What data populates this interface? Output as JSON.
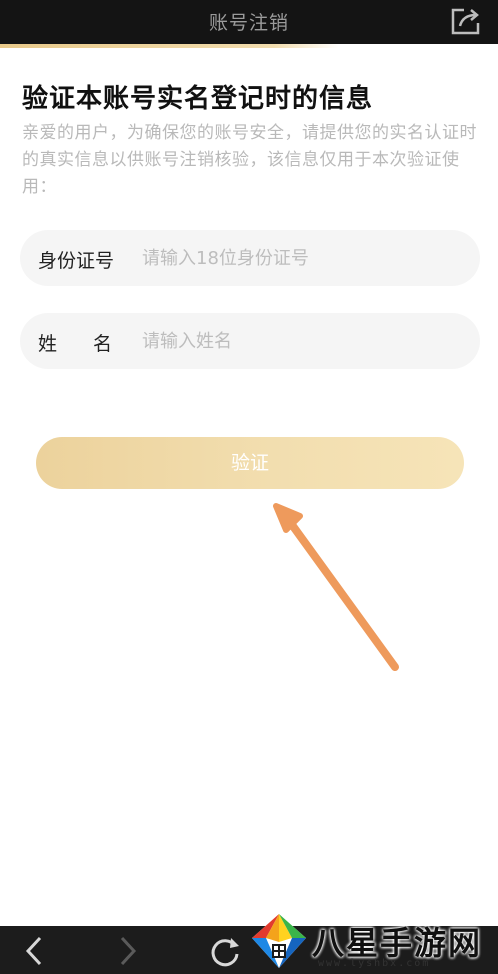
{
  "header": {
    "title": "账号注销",
    "share_icon": "share-icon"
  },
  "main": {
    "title": "验证本账号实名登记时的信息",
    "description": "亲爱的用户，为确保您的账号安全，请提供您的实名认证时的真实信息以供账号注销核验，该信息仅用于本次验证使用：",
    "id_field": {
      "label": "身份证号",
      "placeholder": "请输入18位身份证号",
      "value": ""
    },
    "name_field": {
      "label": "姓名",
      "placeholder": "请输入姓名",
      "value": ""
    },
    "verify_button": "验证"
  },
  "bottom_nav": {
    "back_icon": "back-arrow-icon",
    "forward_icon": "forward-arrow-icon",
    "refresh_icon": "refresh-icon"
  },
  "watermark": {
    "text": "八星手游网",
    "url": "www.lyshbx.com"
  },
  "colors": {
    "accent": "#ecd29c",
    "topbar": "#141414",
    "annotation_arrow": "#ee9a5c"
  }
}
